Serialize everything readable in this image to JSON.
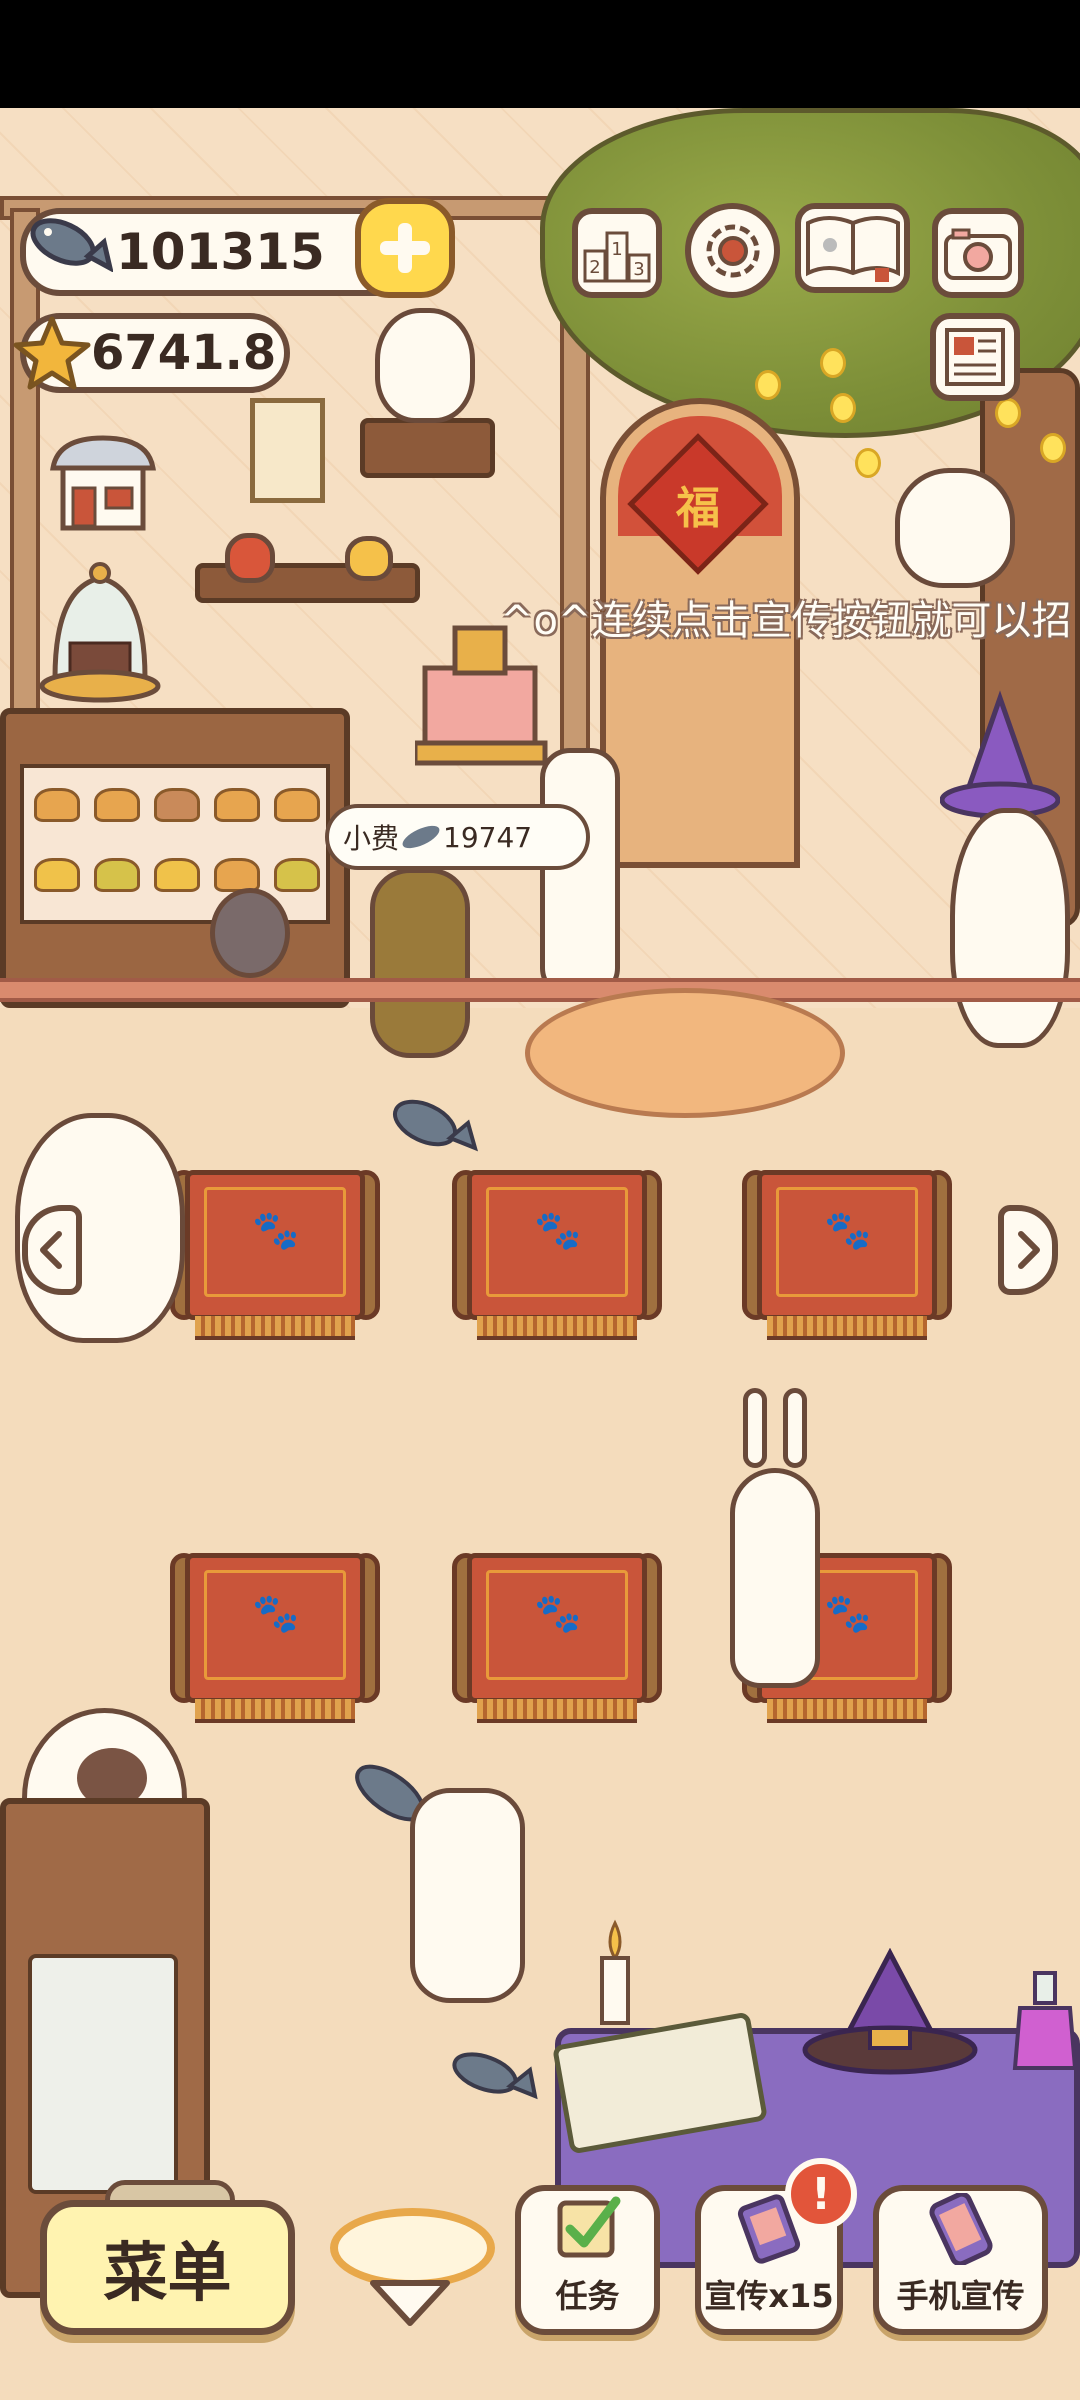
{
  "currency": {
    "fish_count": "101315",
    "star_count": "6741.8"
  },
  "scene": {
    "hint_text": "^o^连续点击宣传按钮就可以招",
    "tip_label": "小费",
    "tip_amount": "19747",
    "door_sign": "福"
  },
  "bottom_bar": {
    "menu_label": "菜单",
    "tasks_label": "任务",
    "promo_label": "宣传x15",
    "promo_alert": "!",
    "phone_promo_label": "手机宣传"
  },
  "icons": {
    "fish": "fish-icon",
    "star": "star-icon",
    "plus": "plus-icon",
    "ranking": "ranking-icon",
    "settings": "gear-icon",
    "album": "paw-book-icon",
    "camera": "camera-icon",
    "newspaper": "newspaper-icon",
    "shop": "shop-icon",
    "arrow_left": "chevron-left-icon",
    "arrow_right": "chevron-right-icon",
    "arrow_down": "chevron-down-icon"
  },
  "colors": {
    "background": "#f4dcbc",
    "outline": "#6b4c3b",
    "accent_yellow": "#ffd84d",
    "table_red": "#c9553a",
    "alert_red": "#e2553a"
  }
}
